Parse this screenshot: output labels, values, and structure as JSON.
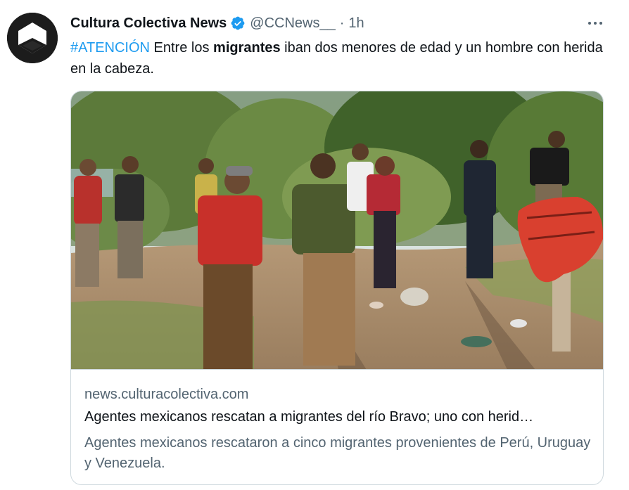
{
  "author": {
    "display_name": "Cultura Colectiva News",
    "handle": "@CCNews__",
    "separator": "·",
    "time": "1h",
    "avatar_icon": "cube-logo-icon",
    "verified_icon": "verified-badge-icon",
    "verified_color": "#1d9bf0"
  },
  "tweet": {
    "hashtag": "#ATENCIÓN",
    "text_part1": " Entre los ",
    "text_bold": "migrantes",
    "text_part2": " iban dos menores de edad y un hombre con herida en la cabeza."
  },
  "card": {
    "image_icon": "photo-rescue-scene",
    "domain": "news.culturacolectiva.com",
    "title": "Agentes mexicanos rescatan a migrantes del río Bravo; uno con herid…",
    "description": "Agentes mexicanos rescataron a cinco migrantes provenientes de Perú, Uruguay y Venezuela."
  },
  "colors": {
    "link": "#1d9bf0",
    "text": "#0f1419",
    "muted": "#536471",
    "border": "#cfd9de"
  }
}
